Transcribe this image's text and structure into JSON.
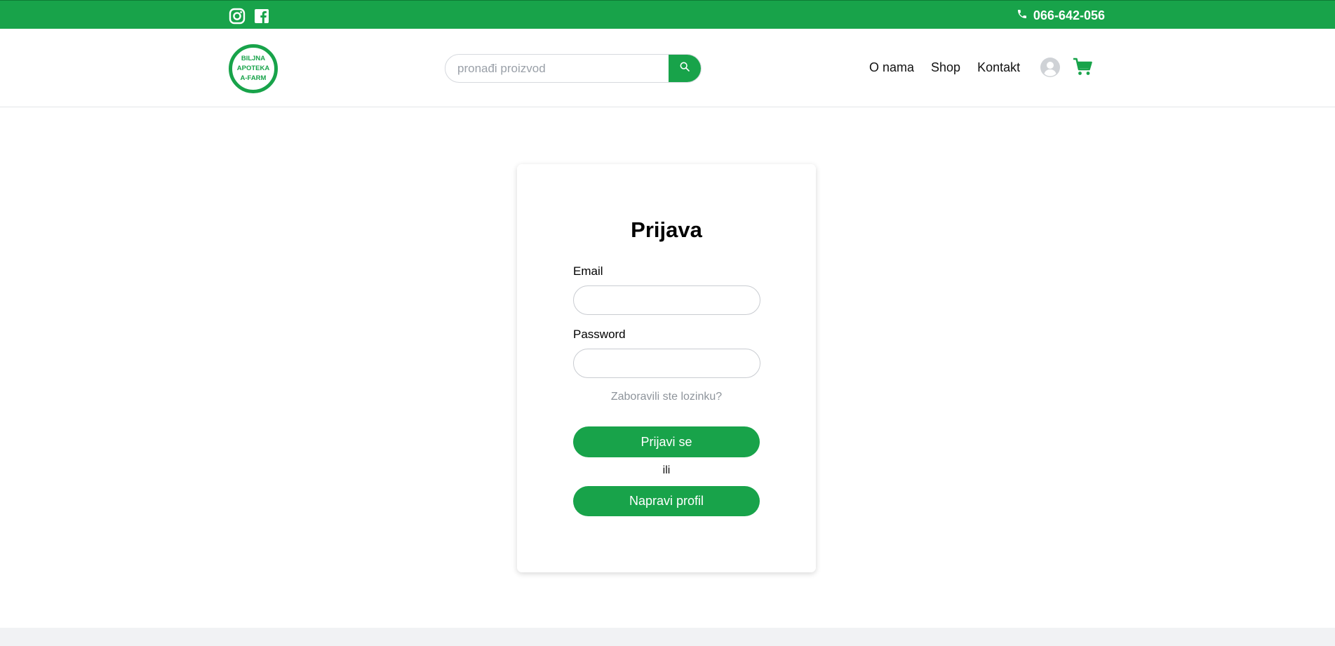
{
  "topbar": {
    "icons": [
      "instagram-icon",
      "facebook-icon"
    ],
    "phone_icon": "phone-icon",
    "phone": "066-642-056"
  },
  "header": {
    "logo_lines": [
      "BILJNA",
      "APOTEKA",
      "A-FARM"
    ],
    "search_placeholder": "pronađi proizvod",
    "search_icon": "search-icon",
    "nav": [
      "O nama",
      "Shop",
      "Kontakt"
    ],
    "user_icon": "user-icon",
    "cart_icon": "cart-icon"
  },
  "login": {
    "title": "Prijava",
    "email_label": "Email",
    "email_value": "",
    "password_label": "Password",
    "password_value": "",
    "forgot_link": "Zaboravili ste lozinku?",
    "login_button": "Prijavi se",
    "or_text": "ili",
    "register_button": "Napravi profil"
  },
  "colors": {
    "brand_green": "#18a34a",
    "muted_text": "#8e949b",
    "footer_bg": "#f1f2f4"
  }
}
